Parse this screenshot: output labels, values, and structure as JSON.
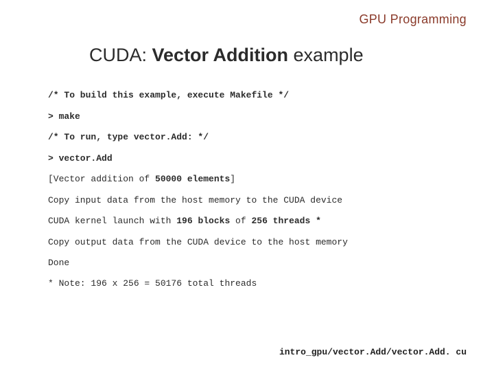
{
  "header": "GPU Programming",
  "title": {
    "pre": "CUDA:  ",
    "bold": "Vector Addition",
    "post": "  example"
  },
  "lines": {
    "c1": "/* To build this example, execute Makefile */",
    "c2": "> make",
    "c3": "/* To run, type vector.Add: */",
    "c4": "> vector.Add",
    "o1_a": "[Vector addition of ",
    "o1_b": "50000 elements",
    "o1_c": "]",
    "o2": "Copy input data from the host memory to the CUDA device",
    "o3_a": "CUDA kernel launch with ",
    "o3_b": "196 blocks",
    "o3_c": " of ",
    "o3_d": "256 threads *",
    "o4": "Copy output data from the CUDA device to the host memory",
    "o5": "Done"
  },
  "note": "* Note: 196 x 256 = 50176 total threads",
  "footer": "intro_gpu/vector.Add/vector.Add. cu"
}
